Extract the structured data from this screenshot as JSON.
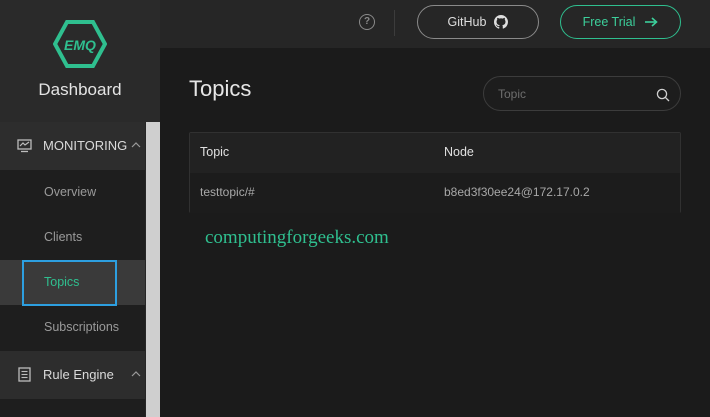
{
  "brand": {
    "logo_text": "EMQ",
    "title": "Dashboard"
  },
  "sidebar": {
    "groups": [
      {
        "label": "MONITORING",
        "icon": "monitor-chart-icon"
      },
      {
        "label": "Rule Engine",
        "icon": "list-doc-icon"
      }
    ],
    "items": [
      {
        "label": "Overview"
      },
      {
        "label": "Clients"
      },
      {
        "label": "Topics",
        "active": true
      },
      {
        "label": "Subscriptions"
      }
    ]
  },
  "header": {
    "help_icon": "?",
    "github_label": "GitHub",
    "trial_label": "Free Trial"
  },
  "main": {
    "title": "Topics",
    "search": {
      "placeholder": "Topic",
      "value": ""
    },
    "table": {
      "columns": [
        "Topic",
        "Node"
      ],
      "rows": [
        {
          "topic": "testtopic/#",
          "node": "b8ed3f30ee24@172.17.0.2"
        }
      ]
    }
  },
  "watermark": "computingforgeeks.com",
  "colors": {
    "accent": "#2fbf8f",
    "focus": "#2d9fe0"
  }
}
